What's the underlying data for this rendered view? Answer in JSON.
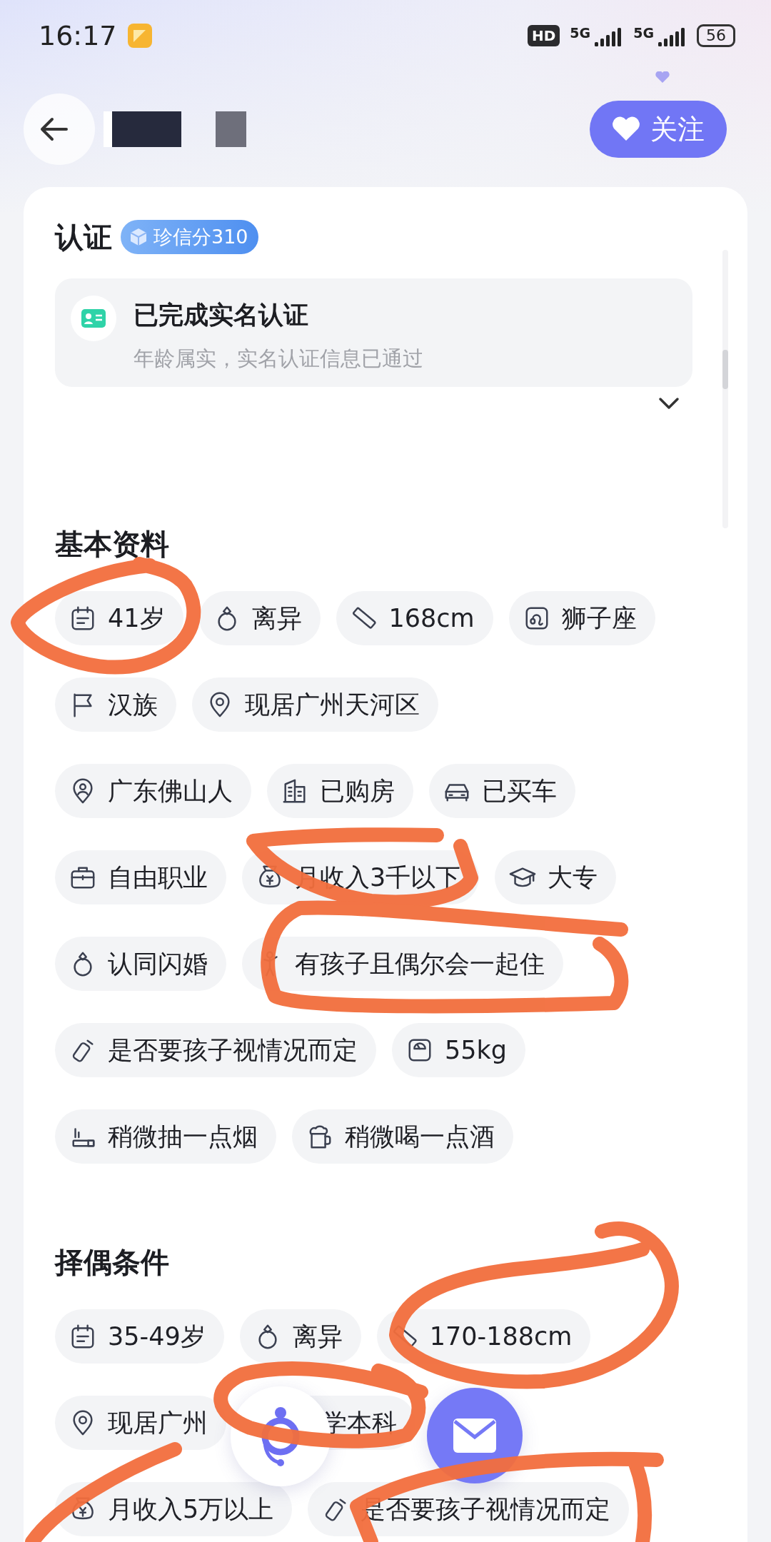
{
  "status_bar": {
    "time": "16:17",
    "network_badge": "HD",
    "sim_1": "5G",
    "sim_2": "5G",
    "battery": "56"
  },
  "header": {
    "follow_button": "关注"
  },
  "verification": {
    "title": "认证",
    "score_badge": "珍信分310",
    "item": {
      "title": "已完成实名认证",
      "subtitle": "年龄属实，实名认证信息已通过"
    }
  },
  "basic_info": {
    "title": "基本资料",
    "rows": [
      [
        {
          "kind": "tag",
          "text": "41岁"
        },
        {
          "kind": "tag",
          "text": "离异"
        },
        {
          "kind": "tag",
          "text": "168cm"
        },
        {
          "kind": "tag",
          "text": "狮子座"
        }
      ],
      [
        {
          "kind": "tag",
          "text": "汉族"
        },
        {
          "kind": "tag",
          "text": "现居广州天河区"
        }
      ],
      [
        {
          "kind": "tag",
          "text": "广东佛山人"
        },
        {
          "kind": "tag",
          "text": "已购房"
        },
        {
          "kind": "tag",
          "text": "已买车"
        }
      ],
      [
        {
          "kind": "tag",
          "text": "自由职业"
        },
        {
          "kind": "tag",
          "text": "月收入3千以下"
        },
        {
          "kind": "tag",
          "text": "大专"
        }
      ],
      [
        {
          "kind": "tag",
          "text": "认同闪婚"
        },
        {
          "kind": "tag",
          "text": "有孩子且偶尔会一起住"
        }
      ],
      [
        {
          "kind": "tag",
          "text": "是否要孩子视情况而定"
        },
        {
          "kind": "tag",
          "text": "55kg"
        }
      ],
      [
        {
          "kind": "tag",
          "text": "稍微抽一点烟"
        },
        {
          "kind": "tag",
          "text": "稍微喝一点酒"
        }
      ]
    ]
  },
  "partner_requirements": {
    "title": "择偶条件",
    "rows": [
      [
        {
          "kind": "tag",
          "text": "35-49岁"
        },
        {
          "kind": "tag",
          "text": "离异"
        },
        {
          "kind": "tag",
          "text": "170-188cm"
        }
      ],
      [
        {
          "kind": "tag",
          "text": "现居广州"
        },
        {
          "kind": "covered",
          "text": "学本科"
        }
      ],
      [
        {
          "kind": "tag",
          "text": "月收入5万以上"
        },
        {
          "kind": "tag",
          "text": "是否要孩子视情况而定"
        }
      ]
    ]
  }
}
